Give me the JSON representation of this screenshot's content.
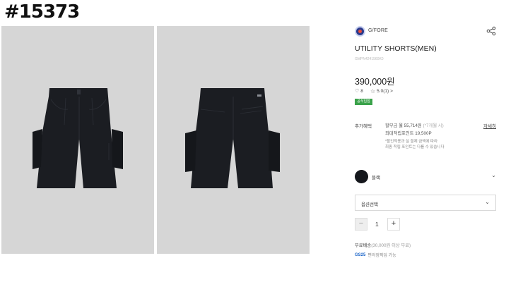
{
  "watermark": "#15373",
  "gallery": {
    "images": [
      {
        "name": "shorts-front-photo",
        "alt": "UTILITY SHORTS(MEN) front"
      },
      {
        "name": "shorts-back-photo",
        "alt": "UTILITY SHORTS(MEN) back"
      }
    ],
    "background_color": "#d6d6d6",
    "garment_color": "#1b1d22"
  },
  "product": {
    "brand": "G/FORE",
    "title": "UTILITY SHORTS(MEN)",
    "code": "GMPN4241560K0",
    "price": "390,000원",
    "likes": "8",
    "rating": "5.0(1)",
    "rating_arrow": ">",
    "badge": "공식입점"
  },
  "benefits": {
    "label": "추가혜택",
    "detail_link": "자세히",
    "installment": "할부금 월 55,714원",
    "installment_note": "(*7개월 시)",
    "points": "최대적립포인트 19,500P",
    "note_line1": "*할인적용과 실 결제 금액에 따라",
    "note_line2": "최종 적립 포인트는 다를 수 있습니다"
  },
  "color_option": {
    "name": "블랙",
    "swatch": "#15171c"
  },
  "option_select": {
    "label": "옵션선택"
  },
  "quantity": {
    "value": "1",
    "minus": "−",
    "plus": "+"
  },
  "shipping": {
    "text": "무료배송",
    "condition": "(30,000원 이상 무료)"
  },
  "pickup": {
    "logo": "GS25",
    "text": "편의점픽업 가능"
  },
  "colors": {
    "accent_green": "#3aa24a"
  }
}
